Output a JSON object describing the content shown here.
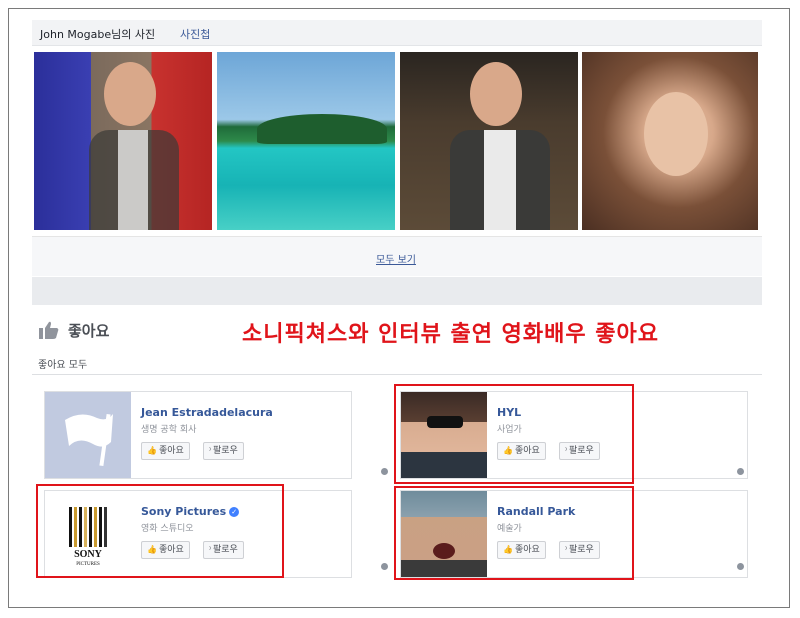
{
  "photos": {
    "owner_label": "John Mogabe님의 사진",
    "album_tab": "사진첩",
    "see_all": "모두 보기"
  },
  "likes": {
    "title": "좋아요",
    "annotation": "소니픽쳐스와 인터뷰 출연 영화배우 좋아요",
    "all_tab": "좋아요 모두",
    "like_label": "좋아요",
    "follow_label": "팔로우",
    "items": [
      {
        "name": "Jean Estradadelacura",
        "category": "생명 공학 회사"
      },
      {
        "name": "HYL",
        "category": "사업가"
      },
      {
        "name": "Sony Pictures",
        "category": "영화 스튜디오"
      },
      {
        "name": "Randall Park",
        "category": "예술가"
      }
    ]
  },
  "icons": {
    "thumb": "thumbs-up-icon",
    "flag": "flag-icon",
    "rss": "rss-icon",
    "verified": "verified-badge-icon",
    "gear": "gear-icon"
  },
  "colors": {
    "link": "#365899",
    "annotation": "#e0141a",
    "header_bg": "#f2f3f5"
  },
  "sony_logo": {
    "line1": "SONY",
    "line2": "PICTURES"
  }
}
